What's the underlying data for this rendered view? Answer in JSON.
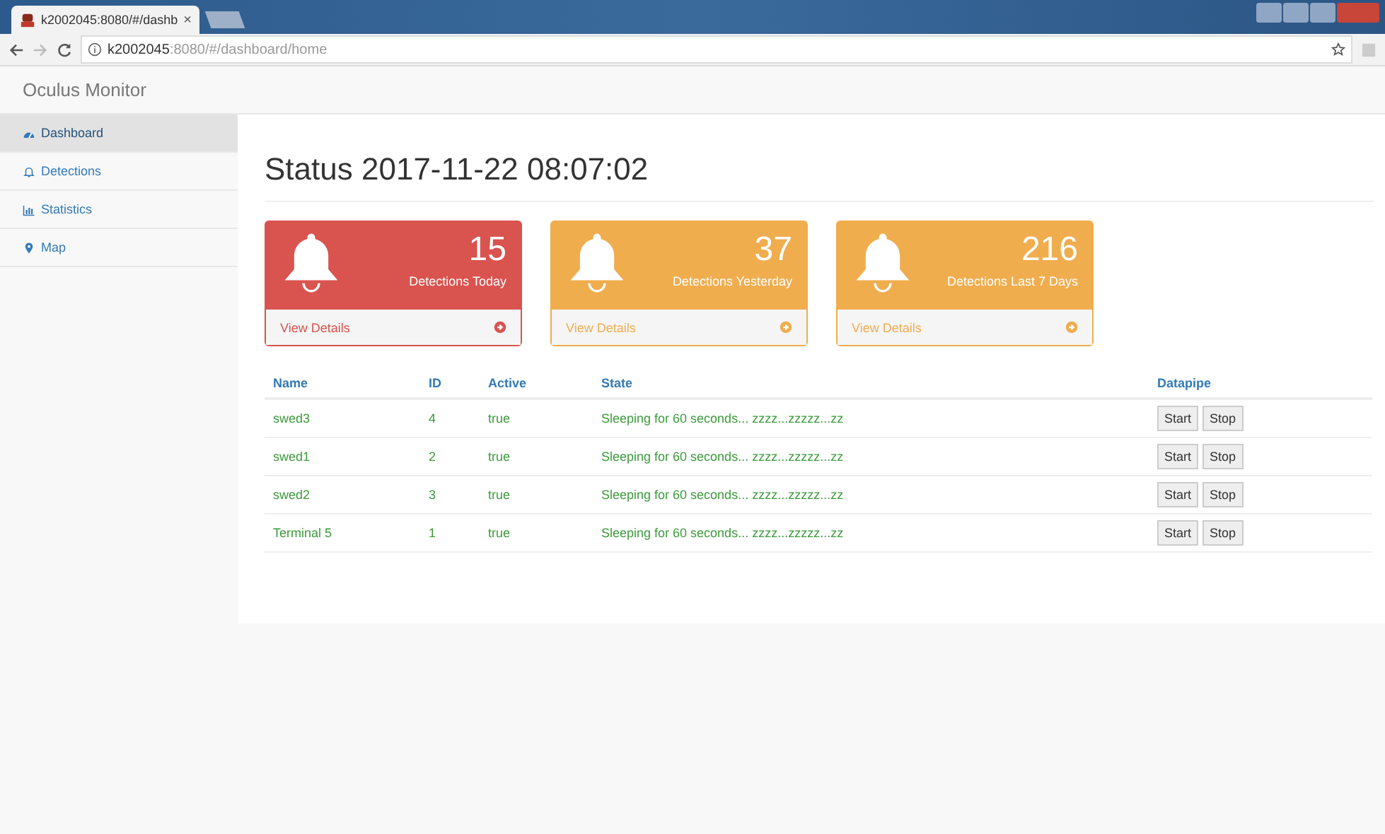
{
  "browser": {
    "tab_title": "k2002045:8080/#/dashb",
    "tab_close": "×",
    "url_host": "k2002045",
    "url_path": ":8080/#/dashboard/home"
  },
  "navbar": {
    "brand": "Oculus Monitor"
  },
  "sidebar": {
    "items": [
      {
        "label": "Dashboard",
        "selected": true
      },
      {
        "label": "Detections",
        "selected": false
      },
      {
        "label": "Statistics",
        "selected": false
      },
      {
        "label": "Map",
        "selected": false
      }
    ]
  },
  "page_title": "Status 2017-11-22 08:07:02",
  "panels": [
    {
      "kind": "danger",
      "count": "15",
      "label": "Detections Today",
      "link": "View Details"
    },
    {
      "kind": "warning",
      "count": "37",
      "label": "Detections Yesterday",
      "link": "View Details"
    },
    {
      "kind": "warning",
      "count": "216",
      "label": "Detections Last 7 Days",
      "link": "View Details"
    }
  ],
  "table": {
    "columns": [
      "Name",
      "ID",
      "Active",
      "State",
      "Datapipe"
    ],
    "rows": [
      {
        "name": "swed3",
        "id": "4",
        "active": "true",
        "state": "Sleeping for 60 seconds... zzzz...zzzzz...zz",
        "buttons": [
          "Start",
          "Stop"
        ]
      },
      {
        "name": "swed1",
        "id": "2",
        "active": "true",
        "state": "Sleeping for 60 seconds... zzzz...zzzzz...zz",
        "buttons": [
          "Start",
          "Stop"
        ]
      },
      {
        "name": "swed2",
        "id": "3",
        "active": "true",
        "state": "Sleeping for 60 seconds... zzzz...zzzzz...zz",
        "buttons": [
          "Start",
          "Stop"
        ]
      },
      {
        "name": "Terminal 5",
        "id": "1",
        "active": "true",
        "state": "Sleeping for 60 seconds... zzzz...zzzzz...zz",
        "buttons": [
          "Start",
          "Stop"
        ]
      }
    ]
  }
}
